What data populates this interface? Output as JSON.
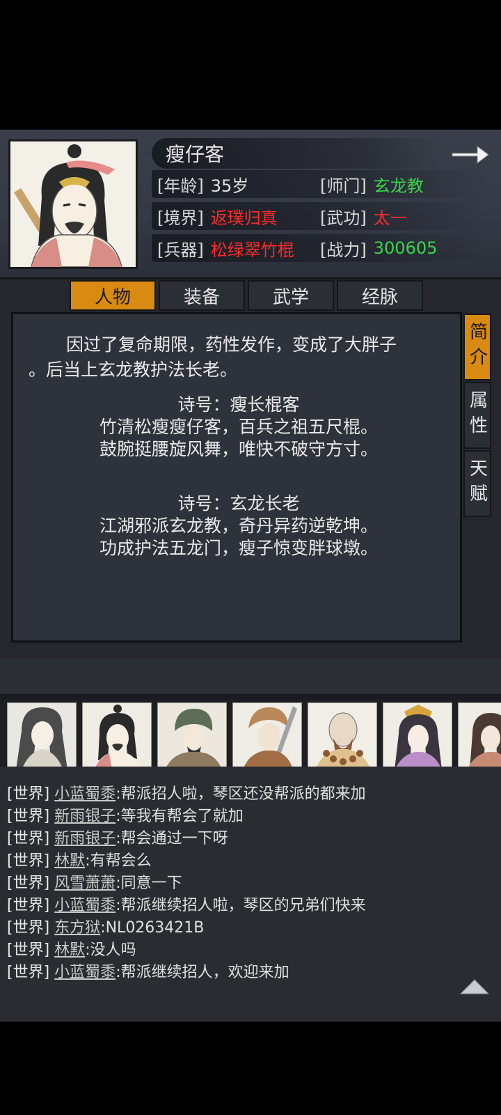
{
  "character": {
    "name": "瘦仔客",
    "stats": [
      {
        "label": "[年龄]",
        "value": "35岁",
        "color": "#e2e2e2"
      },
      {
        "label": "[师门]",
        "value": "玄龙教",
        "color": "#39d64a"
      },
      {
        "label": "[境界]",
        "value": "返璞归真",
        "color": "#ff2a2a"
      },
      {
        "label": "[武功]",
        "value": "太一",
        "color": "#ff2a2a"
      },
      {
        "label": "[兵器]",
        "value": "松绿翠竹棍",
        "color": "#ff2a2a"
      },
      {
        "label": "[战力]",
        "value": "300605",
        "color": "#39d64a"
      }
    ]
  },
  "tabs": [
    "人物",
    "装备",
    "武学",
    "经脉"
  ],
  "active_tab": "人物",
  "side_tabs": [
    "简介",
    "属性",
    "天赋"
  ],
  "active_side_tab": "简介",
  "bio": {
    "intro_line1": "因过了复命期限，药性发作，变成了大胖子",
    "intro_line2": "。后当上玄龙教护法长老。",
    "poem1": {
      "title": "诗号：瘦长棍客",
      "line1": "竹清松瘦瘦仔客，百兵之祖五尺棍。",
      "line2": "鼓腕挺腰旋风舞，唯快不破守方寸。"
    },
    "poem2": {
      "title": "诗号：玄龙长老",
      "line1": "江湖邪派玄龙教，奇丹异药逆乾坤。",
      "line2": "功成护法五龙门，瘦子惊变胖球墩。"
    }
  },
  "chat": [
    {
      "channel": "[世界]",
      "user": "小蓝蜀黍",
      "msg": ":帮派招人啦，琴区还没帮派的都来加"
    },
    {
      "channel": "[世界]",
      "user": "新雨银子",
      "msg": ":等我有帮会了就加"
    },
    {
      "channel": "[世界]",
      "user": "新雨银子",
      "msg": ":帮会通过一下呀"
    },
    {
      "channel": "[世界]",
      "user": "林默",
      "msg": ":有帮会么"
    },
    {
      "channel": "[世界]",
      "user": "风雪萧萧",
      "msg": ":同意一下"
    },
    {
      "channel": "[世界]",
      "user": "小蓝蜀黍",
      "msg": ":帮派继续招人啦，琴区的兄弟们快来"
    },
    {
      "channel": "[世界]",
      "user": "东方狱",
      "msg": ":NL0263421B"
    },
    {
      "channel": "[世界]",
      "user": "林默",
      "msg": ":没人吗"
    },
    {
      "channel": "[世界]",
      "user": "小蓝蜀黍",
      "msg": ":帮派继续招人，欢迎来加"
    }
  ],
  "icons": {
    "next": "right-arrow-icon",
    "scroll_up": "triangle-up-icon"
  },
  "colors": {
    "accent": "#d88a12",
    "red": "#ff2a2a",
    "green": "#39d64a"
  }
}
